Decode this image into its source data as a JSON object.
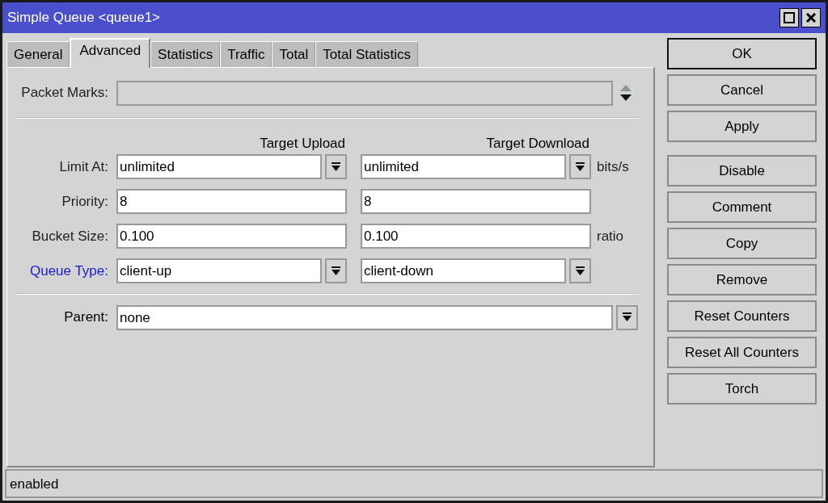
{
  "window": {
    "title": "Simple Queue <queue1>"
  },
  "tabs": [
    {
      "label": "General",
      "selected": false
    },
    {
      "label": "Advanced",
      "selected": true
    },
    {
      "label": "Statistics",
      "selected": false
    },
    {
      "label": "Traffic",
      "selected": false
    },
    {
      "label": "Total",
      "selected": false
    },
    {
      "label": "Total Statistics",
      "selected": false
    }
  ],
  "packet_marks": {
    "label": "Packet Marks:"
  },
  "column_headers": [
    "Target Upload",
    "Target Download"
  ],
  "rows": [
    {
      "label": "Limit At:",
      "link": false,
      "unit": "bits/s",
      "fields": [
        {
          "kind": "combo",
          "value": "unlimited"
        },
        {
          "kind": "combo",
          "value": "unlimited"
        }
      ]
    },
    {
      "label": "Priority:",
      "link": false,
      "fields": [
        {
          "kind": "text",
          "value": "8"
        },
        {
          "kind": "text",
          "value": "8"
        }
      ]
    },
    {
      "label": "Bucket Size:",
      "link": false,
      "unit": "ratio",
      "fields": [
        {
          "kind": "text",
          "value": "0.100"
        },
        {
          "kind": "text",
          "value": "0.100"
        }
      ]
    },
    {
      "label": "Queue Type:",
      "link": true,
      "fields": [
        {
          "kind": "combo",
          "value": "client-up"
        },
        {
          "kind": "combo",
          "value": "client-down"
        }
      ]
    }
  ],
  "parent": {
    "label": "Parent:",
    "value": "none"
  },
  "buttons": [
    {
      "label": "OK",
      "default": true
    },
    {
      "label": "Cancel",
      "default": false
    },
    {
      "label": "Apply",
      "default": false
    },
    {
      "label": "Disable",
      "default": false
    },
    {
      "label": "Comment",
      "default": false
    },
    {
      "label": "Copy",
      "default": false
    },
    {
      "label": "Remove",
      "default": false
    },
    {
      "label": "Reset Counters",
      "default": false
    },
    {
      "label": "Reset All Counters",
      "default": false
    },
    {
      "label": "Torch",
      "default": false
    }
  ],
  "status_bar": "enabled"
}
